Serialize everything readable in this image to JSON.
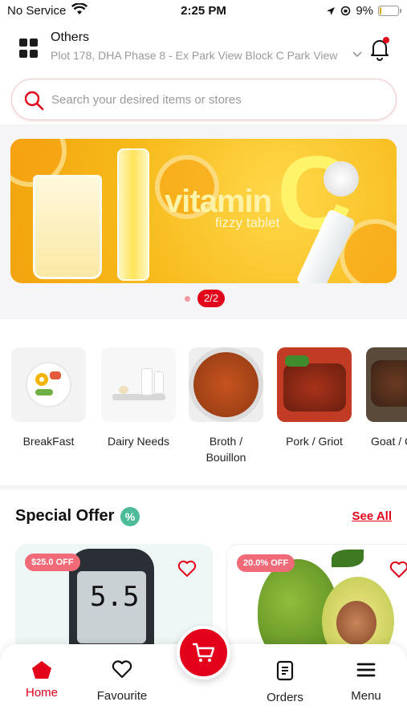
{
  "status_bar": {
    "carrier": "No Service",
    "time": "2:25 PM",
    "battery": "9%",
    "battery_level": 0.09
  },
  "header": {
    "location_title": "Others",
    "location_address": "Plot 178, DHA Phase 8 - Ex Park View Block C Park View",
    "search_placeholder": "Search your desired items or stores"
  },
  "banner": {
    "headline": "vitamin",
    "big_letter": "C",
    "subtitle": "fizzy tablet",
    "page_indicator": "2/2"
  },
  "categories": [
    {
      "label": "BreakFast"
    },
    {
      "label": "Dairy Needs"
    },
    {
      "label": "Broth / Bouillon"
    },
    {
      "label": "Pork / Griot"
    },
    {
      "label": "Goat / C"
    }
  ],
  "special_offer": {
    "title": "Special Offer",
    "badge": "%",
    "see_all": "See All",
    "items": [
      {
        "discount": "$25.0 OFF",
        "device_reading": "5.5"
      },
      {
        "discount": "20.0% OFF"
      }
    ]
  },
  "bottom_nav": {
    "home": "Home",
    "favourite": "Favourite",
    "orders": "Orders",
    "menu": "Menu"
  },
  "colors": {
    "accent": "#e2001a",
    "teal": "#4dbb9a",
    "banner_yellow": "#f7b91a"
  }
}
